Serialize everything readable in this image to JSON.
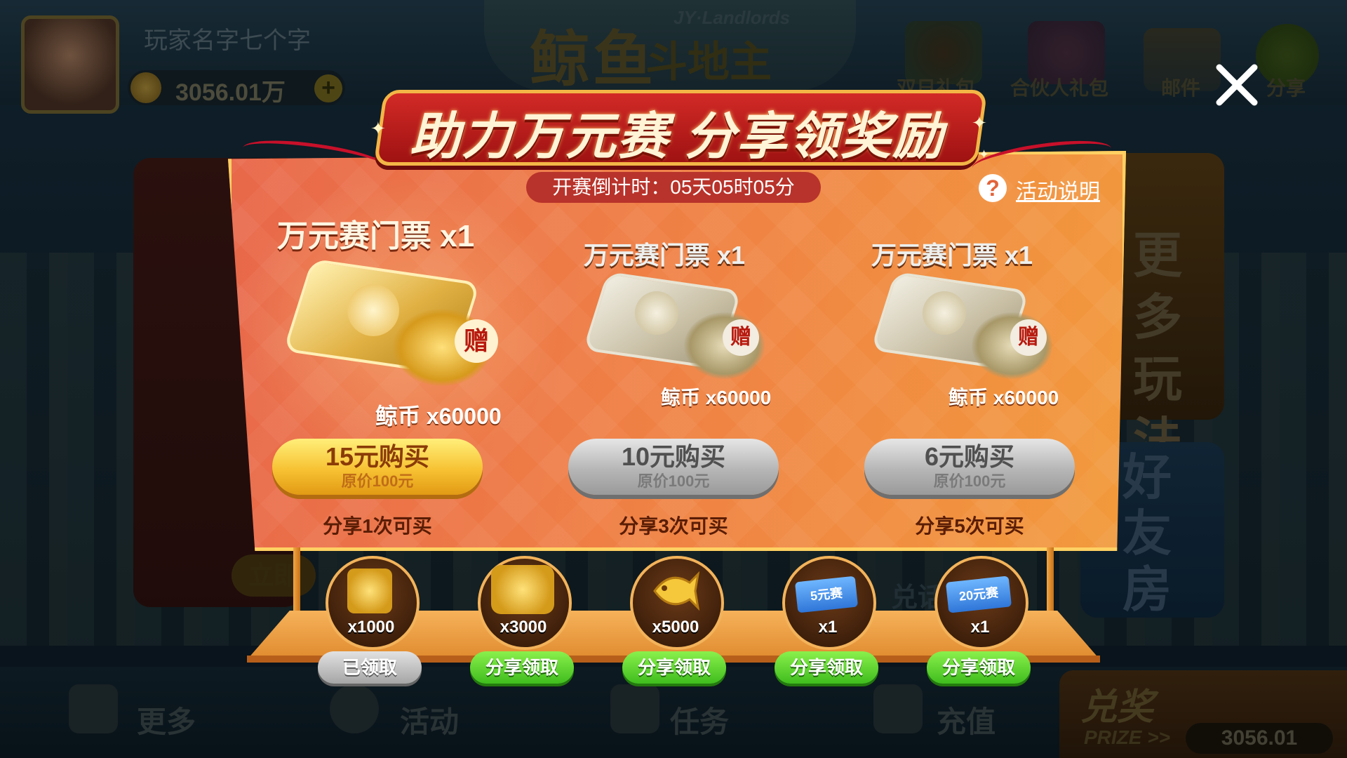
{
  "lobby": {
    "player_name": "玩家名字七个字",
    "coins": "3056.01万",
    "logo_title": "鲸鱼",
    "logo_subtitle": "斗地主",
    "logo_en": "JY·Landlords",
    "top_buttons": [
      {
        "label": "双日礼包",
        "icon": "gift-icon"
      },
      {
        "label": "合伙人礼包",
        "icon": "present-icon"
      },
      {
        "label": "邮件",
        "icon": "mail-icon"
      },
      {
        "label": "分享",
        "icon": "wechat-icon"
      }
    ],
    "right_card_text": "更多玩法",
    "right_card2_text": "好友房",
    "bottom_nav": [
      {
        "label": "更多",
        "icon": "grid-icon"
      },
      {
        "label": "活动",
        "icon": "activity-icon"
      },
      {
        "label": "任务",
        "icon": "task-icon"
      },
      {
        "label": "充值",
        "icon": "cart-icon"
      }
    ],
    "prize_label": "兑奖",
    "prize_en": "PRIZE >>",
    "prize_value": "3056.01",
    "left_card_btn": "立即",
    "exchange_label": "兑话"
  },
  "popup": {
    "title": "助力万元赛 分享领奖励",
    "countdown_label": "开赛倒计时：",
    "countdown_value": "05天05时05分",
    "help_label": "活动说明",
    "products": [
      {
        "name": "万元赛门票 x1",
        "coins_label": "鲸币 x60000",
        "buy_label": "15元购买",
        "original_price": "原价100元",
        "share_note": "分享1次可买",
        "gift_badge": "赠",
        "style": "gold"
      },
      {
        "name": "万元赛门票 x1",
        "coins_label": "鲸币 x60000",
        "buy_label": "10元购买",
        "original_price": "原价100元",
        "share_note": "分享3次可买",
        "gift_badge": "赠",
        "style": "grey"
      },
      {
        "name": "万元赛门票 x1",
        "coins_label": "鲸币 x60000",
        "buy_label": "6元购买",
        "original_price": "原价100元",
        "share_note": "分享5次可买",
        "gift_badge": "赠",
        "style": "grey"
      }
    ],
    "rewards": [
      {
        "qty": "x1000",
        "icon": "gold-coin-stack-icon",
        "button": "已领取",
        "state": "claimed"
      },
      {
        "qty": "x3000",
        "icon": "gold-coin-pile-icon",
        "button": "分享领取",
        "state": "available"
      },
      {
        "qty": "x5000",
        "icon": "gold-fish-icon",
        "button": "分享领取",
        "state": "available"
      },
      {
        "qty": "x1",
        "icon": "ticket-5-icon",
        "ticket_text": "5元赛",
        "button": "分享领取",
        "state": "available"
      },
      {
        "qty": "x1",
        "icon": "ticket-20-icon",
        "ticket_text": "20元赛",
        "button": "分享领取",
        "state": "available"
      }
    ],
    "colors": {
      "panel": "#ef7f45",
      "title_banner": "#d22a26",
      "gold_button": "#f7c233",
      "green_button": "#3fbd1e",
      "grey_button": "#b6b6b6"
    }
  }
}
